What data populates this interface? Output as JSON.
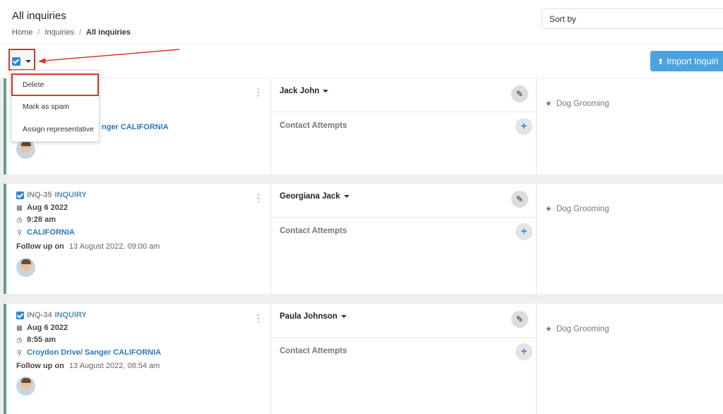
{
  "page": {
    "title": "All inquiries",
    "breadcrumb": [
      "Home",
      "Inquiries",
      "All inquiries"
    ],
    "sort_label": "Sort by"
  },
  "toolbar": {
    "import_label": "Import Inquiri"
  },
  "dropdown": {
    "items": [
      "Delete",
      "Mark as spam",
      "Assign representative"
    ]
  },
  "cards": [
    {
      "id": "",
      "type": "",
      "date": "",
      "time": "",
      "location": "nger CALIFORNIA",
      "follow_up_label": "",
      "follow_up": "",
      "contact": "Jack John",
      "contact_attempts": "Contact Attempts",
      "service": "Dog Grooming"
    },
    {
      "id": "INQ-35",
      "type": "INQUIRY",
      "date": "Aug 6 2022",
      "time": "9:28 am",
      "location": "CALIFORNIA",
      "follow_up_label": "Follow up on",
      "follow_up": "13 August 2022, 09:00 am",
      "contact": "Georgiana Jack",
      "contact_attempts": "Contact Attempts",
      "service": "Dog Grooming"
    },
    {
      "id": "INQ-34",
      "type": "INQUIRY",
      "date": "Aug 6 2022",
      "time": "8:55 am",
      "location": "Croydon Drive/ Sanger CALIFORNIA",
      "follow_up_label": "Follow up on",
      "follow_up": "13 August 2022, 08:54 am",
      "contact": "Paula Johnson",
      "contact_attempts": "Contact Attempts",
      "service": "Dog Grooming"
    }
  ],
  "colors": {
    "accent": "#4ba3e0",
    "highlight": "#d23a2a",
    "card_border": "#6a9c8c",
    "link": "#2f78b5"
  }
}
